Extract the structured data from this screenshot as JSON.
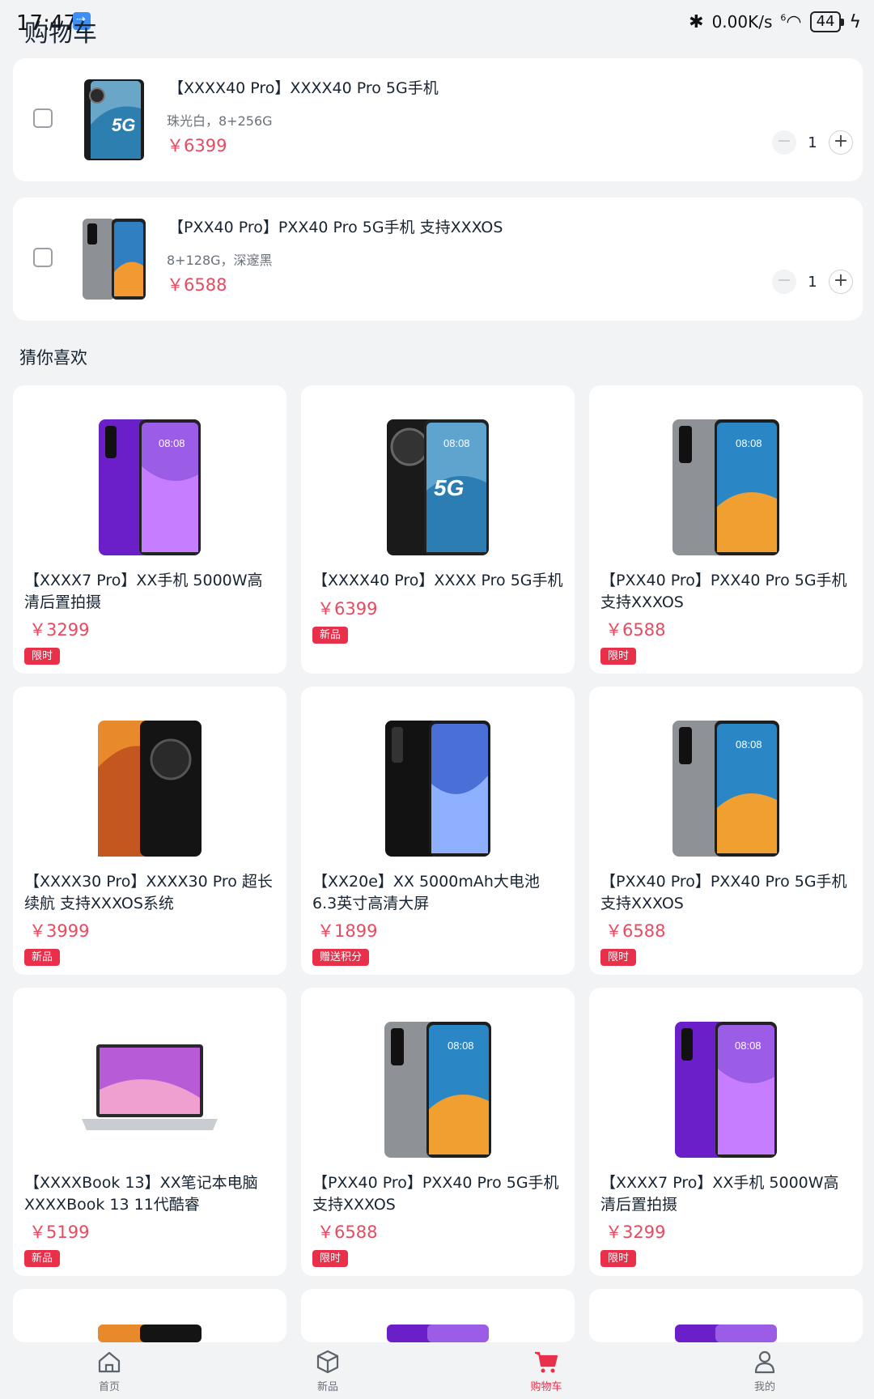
{
  "status_bar": {
    "time": "17:47",
    "network_speed": "0.00K/s",
    "wifi_label": "6",
    "battery": "44"
  },
  "page": {
    "title": "购物车"
  },
  "cart": {
    "items": [
      {
        "name": "【XXXX40 Pro】XXXX40 Pro 5G手机",
        "spec": "珠光白，8+256G",
        "price": "￥6399",
        "quantity": "1"
      },
      {
        "name": "【PXX40 Pro】PXX40 Pro 5G手机 支持XXXOS",
        "spec": "8+128G，深邃黑",
        "price": "￥6588",
        "quantity": "1"
      }
    ],
    "minus_symbol": "−",
    "plus_symbol": "+"
  },
  "recommend": {
    "title": "猜你喜欢",
    "products": [
      {
        "name": "【XXXX7 Pro】XX手机 5000W高清后置拍摄",
        "price": "￥3299",
        "badge": "限时"
      },
      {
        "name": "【XXXX40 Pro】XXXX Pro 5G手机",
        "price": "￥6399",
        "badge": "新品"
      },
      {
        "name": "【PXX40 Pro】PXX40 Pro 5G手机 支持XXXOS",
        "price": "￥6588",
        "badge": "限时"
      },
      {
        "name": "【XXXX30 Pro】XXXX30 Pro 超长续航 支持XXXOS系统",
        "price": "￥3999",
        "badge": "新品"
      },
      {
        "name": "【XX20e】XX 5000mAh大电池 6.3英寸高清大屏",
        "price": "￥1899",
        "badge": "赠送积分"
      },
      {
        "name": "【PXX40 Pro】PXX40 Pro 5G手机 支持XXXOS",
        "price": "￥6588",
        "badge": "限时"
      },
      {
        "name": "【XXXXBook 13】XX笔记本电脑 XXXXBook 13 11代酷睿",
        "price": "￥5199",
        "badge": "新品"
      },
      {
        "name": "【PXX40 Pro】PXX40 Pro 5G手机 支持XXXOS",
        "price": "￥6588",
        "badge": "限时"
      },
      {
        "name": "【XXXX7 Pro】XX手机 5000W高清后置拍摄",
        "price": "￥3299",
        "badge": "限时"
      }
    ]
  },
  "bottom_nav": {
    "items": [
      {
        "label": "首页",
        "icon": "home-icon"
      },
      {
        "label": "新品",
        "icon": "box-icon"
      },
      {
        "label": "购物车",
        "icon": "cart-icon"
      },
      {
        "label": "我的",
        "icon": "person-icon"
      }
    ],
    "active": "购物车"
  },
  "colors": {
    "price": "#e84a5f",
    "badge": "#e8304a",
    "background": "#f1f3f5",
    "active_nav": "#e8304a"
  }
}
